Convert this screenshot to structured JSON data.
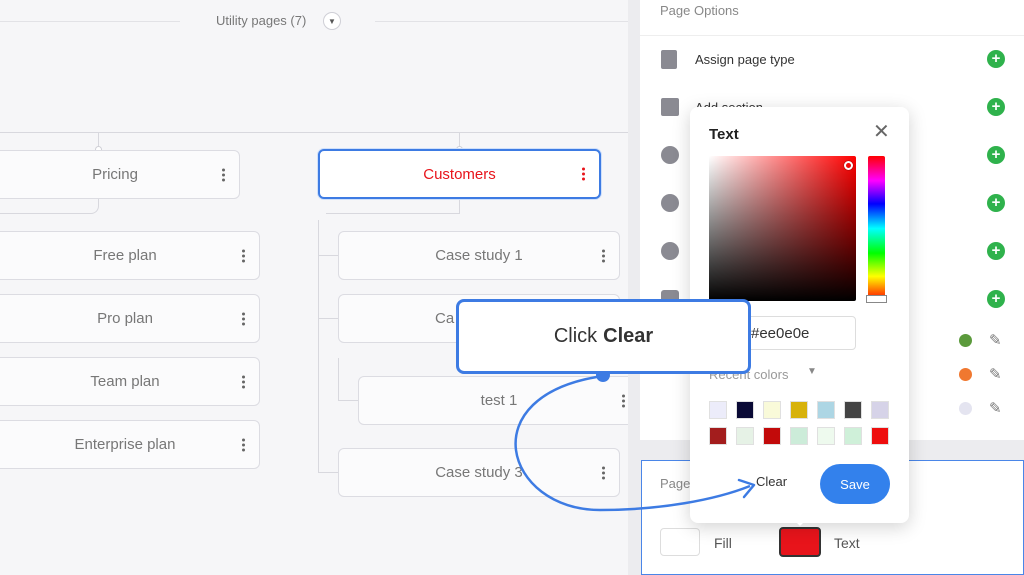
{
  "utility": {
    "label": "Utility pages (7)",
    "toggle_icon": "chevron-down-icon"
  },
  "sitemap": {
    "pricing": {
      "label": "Pricing"
    },
    "customers": {
      "label": "Customers"
    },
    "pricing_children": [
      {
        "label": "Free plan"
      },
      {
        "label": "Pro plan"
      },
      {
        "label": "Team plan"
      },
      {
        "label": "Enterprise plan"
      }
    ],
    "customers_children": [
      {
        "label": "Case study 1"
      },
      {
        "label": "Ca"
      },
      {
        "label": "test 1"
      },
      {
        "label": "Case study 3"
      }
    ]
  },
  "panel": {
    "title": "Page Options",
    "options": [
      {
        "label": "Assign page type",
        "icon": "document-icon"
      },
      {
        "label": "Add section",
        "icon": "folder-plus-icon"
      },
      {
        "label": "",
        "icon": "palette-icon"
      },
      {
        "label": "",
        "icon": "copy-icon"
      },
      {
        "label": "",
        "icon": "comment-icon"
      },
      {
        "label": "",
        "icon": "tag-icon"
      }
    ],
    "color_rows": [
      {
        "color": "#5b9a3c"
      },
      {
        "color": "#f07830"
      },
      {
        "color": "#e4e4f0"
      }
    ],
    "bottom_section": {
      "label": "Page",
      "fill_label": "Fill",
      "text_label": "Text",
      "text_color": "#e8141b"
    }
  },
  "color_picker": {
    "title": "Text",
    "hex_value": "#ee0e0e",
    "recent_label": "Recent colors",
    "recent_colors": [
      "#ececfa",
      "#0a0a35",
      "#f9fad9",
      "#d7b20c",
      "#add6e4",
      "#444444",
      "#d6d3e8",
      "#a31d1d",
      "#e6f2e6",
      "#c20a0a",
      "#ccecd9",
      "#eefaee",
      "#cff0d9",
      "#ee0e0e"
    ],
    "clear_label": "Clear",
    "save_label": "Save"
  },
  "callout": {
    "prefix": "Click",
    "emphasis": "Clear"
  }
}
